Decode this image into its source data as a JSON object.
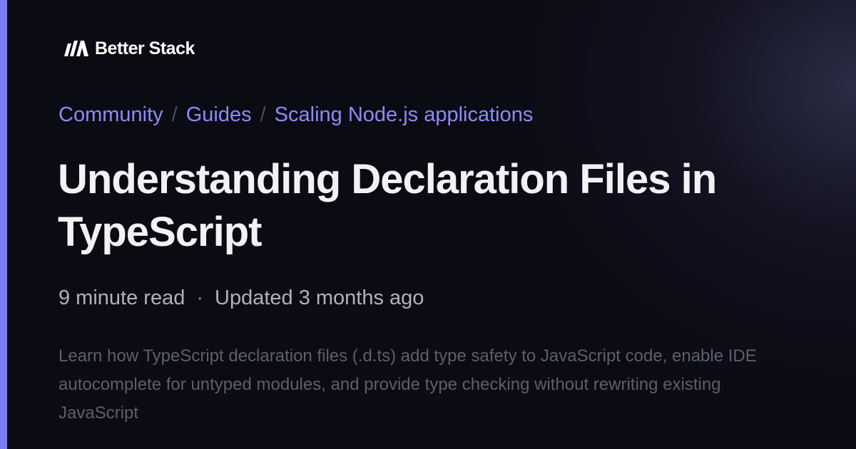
{
  "brand": {
    "name": "Better Stack",
    "icon": "better-stack-logo-icon",
    "accent_color": "#7b7cf5"
  },
  "breadcrumb": {
    "items": [
      "Community",
      "Guides",
      "Scaling Node.js applications"
    ],
    "separator": "/"
  },
  "article": {
    "title": "Understanding Declaration Files in TypeScript",
    "read_time": "9 minute read",
    "meta_separator": "·",
    "updated": "Updated 3 months ago",
    "description": "Learn how TypeScript declaration files (.d.ts) add type safety to JavaScript code, enable IDE autocomplete for untyped modules, and provide type checking without rewriting existing JavaScript"
  },
  "colors": {
    "background": "#0b0b14",
    "link": "#8b8cf8",
    "title": "#f2f2f5",
    "meta": "#b0b1bc",
    "description": "#5d5e6e"
  }
}
